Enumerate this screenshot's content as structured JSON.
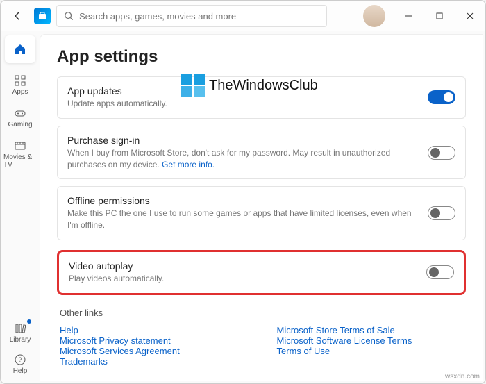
{
  "titlebar": {
    "search_placeholder": "Search apps, games, movies and more"
  },
  "sidebar": {
    "apps": "Apps",
    "gaming": "Gaming",
    "movies": "Movies & TV",
    "library": "Library",
    "help": "Help"
  },
  "page": {
    "title": "App settings"
  },
  "settings": {
    "app_updates": {
      "title": "App updates",
      "desc": "Update apps automatically."
    },
    "purchase_signin": {
      "title": "Purchase sign-in",
      "desc": "When I buy from Microsoft Store, don't ask for my password. May result in unauthorized purchases on my device. ",
      "more": "Get more info."
    },
    "offline": {
      "title": "Offline permissions",
      "desc": "Make this PC the one I use to run some games or apps that have limited licenses, even when I'm offline."
    },
    "video": {
      "title": "Video autoplay",
      "desc": "Play videos automatically."
    }
  },
  "other_links": {
    "title": "Other links",
    "col1": [
      "Help",
      "Microsoft Privacy statement",
      "Microsoft Services Agreement",
      "Trademarks"
    ],
    "col2": [
      "Microsoft Store Terms of Sale",
      "Microsoft Software License Terms",
      "Terms of Use"
    ]
  },
  "overlay": {
    "brand": "TheWindowsClub"
  },
  "credit": "wsxdn.com"
}
